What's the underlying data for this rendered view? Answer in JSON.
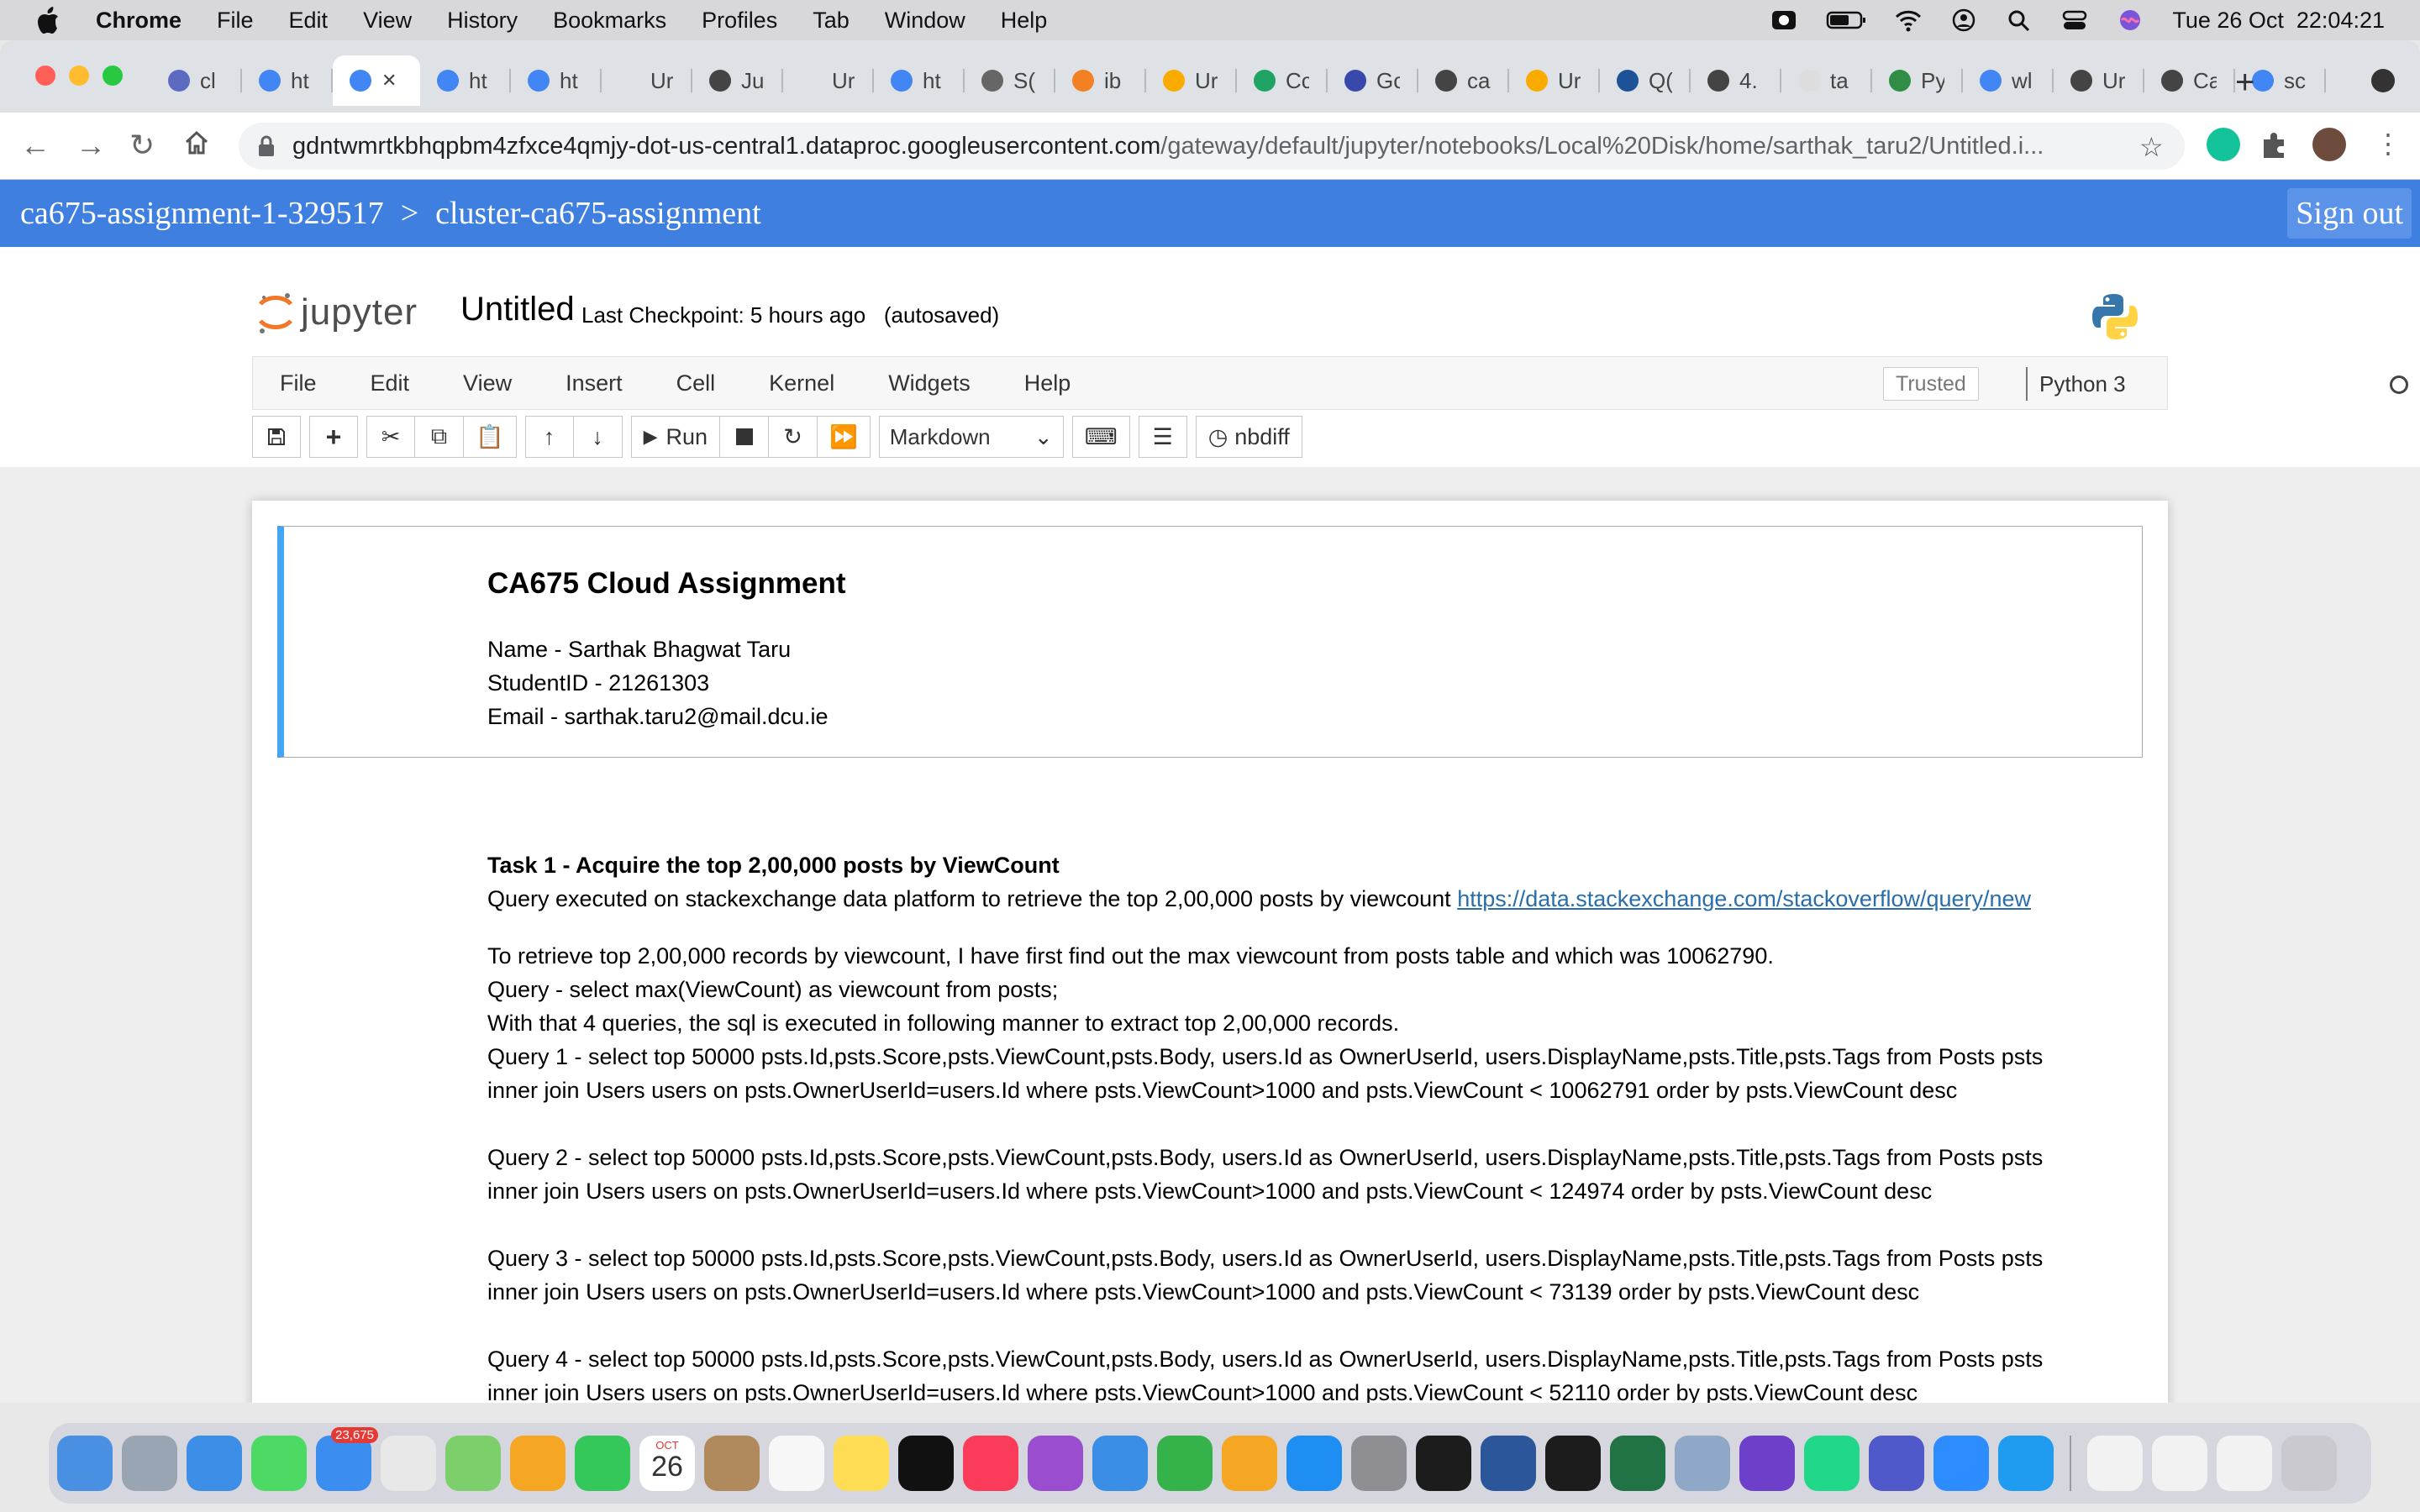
{
  "menubar": {
    "app": "Chrome",
    "items": [
      "File",
      "Edit",
      "View",
      "History",
      "Bookmarks",
      "Profiles",
      "Tab",
      "Window",
      "Help"
    ],
    "datetime": "Tue 26 Oct  22:04:21"
  },
  "browser": {
    "tabs": [
      {
        "label": "cl",
        "icon": "network-icon",
        "color": "#5c6bc0"
      },
      {
        "label": "ht",
        "icon": "google-icon",
        "color": "#4285f4"
      },
      {
        "label": "",
        "icon": "google-icon",
        "color": "#4285f4",
        "active": true
      },
      {
        "label": "ht",
        "icon": "google-icon",
        "color": "#4285f4"
      },
      {
        "label": "ht",
        "icon": "google-icon",
        "color": "#4285f4"
      },
      {
        "label": "Ur",
        "icon": "blank-icon",
        "color": "#dee1e6"
      },
      {
        "label": "Ju",
        "icon": "globe-icon",
        "color": "#444444"
      },
      {
        "label": "Ur",
        "icon": "blank-icon",
        "color": "#dee1e6"
      },
      {
        "label": "ht",
        "icon": "google-icon",
        "color": "#4285f4"
      },
      {
        "label": "S(",
        "icon": "gear-icon",
        "color": "#666666"
      },
      {
        "label": "ib",
        "icon": "stackoverflow-icon",
        "color": "#f48024"
      },
      {
        "label": "Ur",
        "icon": "colab-icon",
        "color": "#f9ab00"
      },
      {
        "label": "Cc",
        "icon": "drive-icon",
        "color": "#1fa463"
      },
      {
        "label": "Gc",
        "icon": "forms-icon",
        "color": "#3949ab"
      },
      {
        "label": "ca",
        "icon": "globe-icon",
        "color": "#444444"
      },
      {
        "label": "Ur",
        "icon": "colab-icon",
        "color": "#f9ab00"
      },
      {
        "label": "Q(",
        "icon": "stackexchange-icon",
        "color": "#1e5297"
      },
      {
        "label": "4.",
        "icon": "globe-icon",
        "color": "#444444"
      },
      {
        "label": "ta",
        "icon": "cube-icon",
        "color": "#dddddd"
      },
      {
        "label": "Py",
        "icon": "geeks-icon",
        "color": "#2f8d46"
      },
      {
        "label": "wl",
        "icon": "google-icon",
        "color": "#4285f4"
      },
      {
        "label": "Ur",
        "icon": "globe-icon",
        "color": "#444444"
      },
      {
        "label": "Ca",
        "icon": "globe-icon",
        "color": "#444444"
      },
      {
        "label": "sc",
        "icon": "google-icon",
        "color": "#4285f4"
      }
    ],
    "url_host": "gdntwmrtkbhqpbm4zfxce4qmjy-dot-us-central1.dataproc.googleusercontent.com",
    "url_path": "/gateway/default/jupyter/notebooks/Local%20Disk/home/sarthak_taru2/Untitled.i..."
  },
  "dataproc": {
    "project": "ca675-assignment-1-329517",
    "separator": ">",
    "cluster": "cluster-ca675-assignment",
    "signout": "Sign out"
  },
  "jupyter": {
    "logo_text": "jupyter",
    "notebook_name": "Untitled",
    "checkpoint": "Last Checkpoint: 5 hours ago   (autosaved)",
    "menu": [
      "File",
      "Edit",
      "View",
      "Insert",
      "Cell",
      "Kernel",
      "Widgets",
      "Help"
    ],
    "trusted": "Trusted",
    "kernel": "Python 3",
    "run_label": "Run",
    "cell_type": "Markdown",
    "nbdiff": "nbdiff"
  },
  "cell1": {
    "heading": "CA675 Cloud Assignment",
    "name": "Name - Sarthak Bhagwat Taru",
    "student_id": "StudentID - 21261303",
    "email": "Email - sarthak.taru2@mail.dcu.ie"
  },
  "cell2": {
    "task_title": "Task 1 - Acquire the top 2,00,000 posts by ViewCount",
    "query_intro": "Query executed on stackexchange data platform to retrieve the top 2,00,000 posts by viewcount ",
    "query_link": "https://data.stackexchange.com/stackoverflow/query/new",
    "para1": "To retrieve top 2,00,000 records by viewcount, I have first find out the max viewcount from posts table and which was 10062790.",
    "para2": "Query - select max(ViewCount) as viewcount from posts;",
    "para3": "With that 4 queries, the sql is executed in following manner to extract top 2,00,000 records.",
    "queries": [
      {
        "line1": "Query 1 - select top 50000 psts.Id,psts.Score,psts.ViewCount,psts.Body, users.Id as OwnerUserId, users.DisplayName,psts.Title,psts.Tags from Posts psts",
        "line2": "inner join Users users on psts.OwnerUserId=users.Id where psts.ViewCount>1000 and psts.ViewCount < 10062791 order by psts.ViewCount desc"
      },
      {
        "line1": "Query 2 - select top 50000 psts.Id,psts.Score,psts.ViewCount,psts.Body, users.Id as OwnerUserId, users.DisplayName,psts.Title,psts.Tags from Posts psts",
        "line2": "inner join Users users on psts.OwnerUserId=users.Id where psts.ViewCount>1000 and psts.ViewCount < 124974 order by psts.ViewCount desc"
      },
      {
        "line1": "Query 3 - select top 50000 psts.Id,psts.Score,psts.ViewCount,psts.Body, users.Id as OwnerUserId, users.DisplayName,psts.Title,psts.Tags from Posts psts",
        "line2": "inner join Users users on psts.OwnerUserId=users.Id where psts.ViewCount>1000 and psts.ViewCount < 73139 order by psts.ViewCount desc"
      },
      {
        "line1": "Query 4 - select top 50000 psts.Id,psts.Score,psts.ViewCount,psts.Body, users.Id as OwnerUserId, users.DisplayName,psts.Title,psts.Tags from Posts psts",
        "line2": "inner join Users users on psts.OwnerUserId=users.Id where psts.ViewCount>1000 and psts.ViewCount < 52110 order by psts.ViewCount desc"
      }
    ]
  },
  "dock": {
    "mail_badge": "23,675",
    "calendar_month": "OCT",
    "calendar_day": "26",
    "apps": [
      {
        "name": "finder-icon",
        "color": "#4a90e2"
      },
      {
        "name": "launchpad-icon",
        "color": "#9aa5b4"
      },
      {
        "name": "safari-icon",
        "color": "#3d8ee6"
      },
      {
        "name": "messages-icon",
        "color": "#4cd964"
      },
      {
        "name": "mail-icon",
        "color": "#3b8def"
      },
      {
        "name": "chrome-icon",
        "color": "#e8e8e8"
      },
      {
        "name": "maps-icon",
        "color": "#7ccf6a"
      },
      {
        "name": "photos-icon",
        "color": "#f5a623"
      },
      {
        "name": "facetime-icon",
        "color": "#34c759"
      },
      {
        "name": "calendar-icon",
        "color": "#ffffff"
      },
      {
        "name": "contacts-icon",
        "color": "#b08a5c"
      },
      {
        "name": "reminders-icon",
        "color": "#f7f7f7"
      },
      {
        "name": "notes-icon",
        "color": "#fedd55"
      },
      {
        "name": "appletv-icon",
        "color": "#111111"
      },
      {
        "name": "music-icon",
        "color": "#fa3c5a"
      },
      {
        "name": "podcasts-icon",
        "color": "#9b4dd0"
      },
      {
        "name": "keynote-icon",
        "color": "#3a8ee6"
      },
      {
        "name": "numbers-icon",
        "color": "#35b34a"
      },
      {
        "name": "pages-icon",
        "color": "#f5a623"
      },
      {
        "name": "appstore-icon",
        "color": "#1e8ef2"
      },
      {
        "name": "settings-icon",
        "color": "#8e8e93"
      },
      {
        "name": "terminal-icon",
        "color": "#1c1c1c"
      },
      {
        "name": "word-icon",
        "color": "#2b579a"
      },
      {
        "name": "activity-icon",
        "color": "#1c1c1c"
      },
      {
        "name": "excel-icon",
        "color": "#217346"
      },
      {
        "name": "preview-icon",
        "color": "#8fa8c8"
      },
      {
        "name": "github-icon",
        "color": "#6e40c9"
      },
      {
        "name": "pycharm-icon",
        "color": "#21d789"
      },
      {
        "name": "teams-icon",
        "color": "#5059c9"
      },
      {
        "name": "zoom-icon",
        "color": "#2d8cff"
      },
      {
        "name": "vscode-icon",
        "color": "#1f9cf0"
      }
    ],
    "recent": [
      {
        "name": "document-icon",
        "color": "#f2f2f2"
      },
      {
        "name": "document-icon",
        "color": "#f2f2f2"
      },
      {
        "name": "document-icon",
        "color": "#f2f2f2"
      },
      {
        "name": "trash-icon",
        "color": "#c9c9cf"
      }
    ]
  }
}
